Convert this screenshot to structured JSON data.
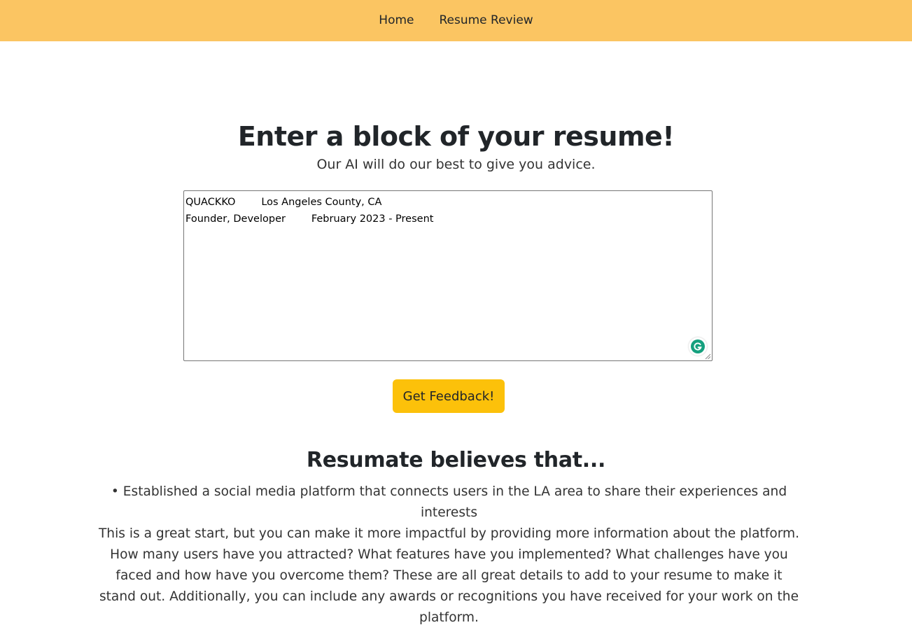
{
  "nav": {
    "items": [
      {
        "label": "Home"
      },
      {
        "label": "Resume Review"
      }
    ]
  },
  "hero": {
    "title": "Enter a block of your resume!",
    "subtitle": "Our AI will do our best to give you advice."
  },
  "resume_input": {
    "value": "QUACKKO        Los Angeles County, CA\nFounder, Developer        February 2023 - Present",
    "extension_icon": "grammarly-icon"
  },
  "submit": {
    "label": "Get Feedback!"
  },
  "result": {
    "title": "Resumate believes that...",
    "bullet": "• Established a social media platform that connects users in the LA area to share their experiences and interests",
    "feedback": "This is a great start, but you can make it more impactful by providing more information about the platform. How many users have you attracted? What features have you implemented? What challenges have you faced and how have you overcome them? These are all great details to add to your resume to make it stand out. Additionally, you can include any awards or recognitions you have received for your work on the platform."
  },
  "colors": {
    "navbar": "#fbc562",
    "button": "#fcc10a",
    "grammarly": "#15a07e"
  }
}
